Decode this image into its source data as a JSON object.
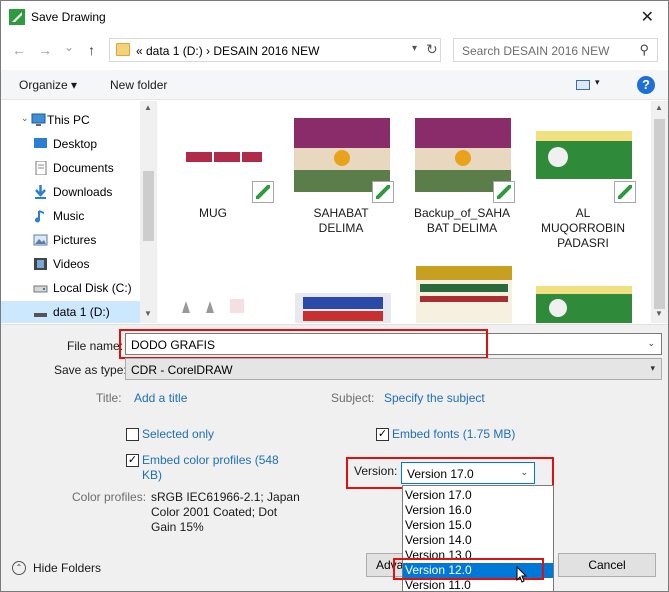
{
  "window": {
    "title": "Save Drawing",
    "close_glyph": "✕"
  },
  "address": {
    "back": "←",
    "forward": "→",
    "recent": "⌄",
    "up": "↑",
    "crumbs": "«  data  1 (D:)  ›  DESAIN 2016 NEW",
    "search_placeholder": "Search DESAIN 2016 NEW"
  },
  "toolbar": {
    "organize": "Organize ▾",
    "new_folder": "New folder",
    "help": "?"
  },
  "nav": {
    "items": [
      {
        "label": "This PC",
        "icon": "computer-icon"
      },
      {
        "label": "Desktop",
        "icon": "desktop-icon"
      },
      {
        "label": "Documents",
        "icon": "documents-icon"
      },
      {
        "label": "Downloads",
        "icon": "downloads-icon"
      },
      {
        "label": "Music",
        "icon": "music-icon"
      },
      {
        "label": "Pictures",
        "icon": "pictures-icon"
      },
      {
        "label": "Videos",
        "icon": "videos-icon"
      },
      {
        "label": "Local Disk (C:)",
        "icon": "drive-icon"
      },
      {
        "label": "data  1 (D:)",
        "icon": "drive-icon"
      }
    ]
  },
  "files": [
    {
      "name": "MUG",
      "name2": ""
    },
    {
      "name": "SAHABAT",
      "name2": "DELIMA"
    },
    {
      "name": "Backup_of_SAHA",
      "name2": "BAT DELIMA"
    },
    {
      "name": "AL",
      "name2": "MUQORROBIN",
      "name3": "PADASRI"
    }
  ],
  "form": {
    "file_name_label": "File name:",
    "file_name_value": "DODO GRAFIS",
    "save_type_label": "Save as type:",
    "save_type_value": "CDR - CorelDRAW",
    "title_label": "Title:",
    "title_link": "Add a title",
    "subject_label": "Subject:",
    "subject_link": "Specify the subject",
    "selected_only": "Selected only",
    "embed_fonts": "Embed fonts (1.75 MB)",
    "embed_profiles_1": "Embed color profiles (548",
    "embed_profiles_2": "KB)",
    "version_label": "Version:",
    "version_value": "Version 17.0",
    "color_profiles_label": "Color profiles:",
    "color_profiles_1": "sRGB IEC61966-2.1; Japan",
    "color_profiles_2": "Color 2001 Coated; Dot",
    "color_profiles_3": "Gain 15%",
    "hide_folders": "Hide Folders",
    "advanced": "Adva",
    "cancel": "Cancel"
  },
  "version_options": [
    "Version 17.0",
    "Version 16.0",
    "Version 15.0",
    "Version 14.0",
    "Version 13.0",
    "Version 12.0",
    "Version 11.0"
  ],
  "version_highlighted": "Version 12.0",
  "colors": {
    "accent": "#0078d7",
    "link": "#1e6fb9",
    "highlight": "#e01010",
    "selection": "#cce8ff"
  }
}
